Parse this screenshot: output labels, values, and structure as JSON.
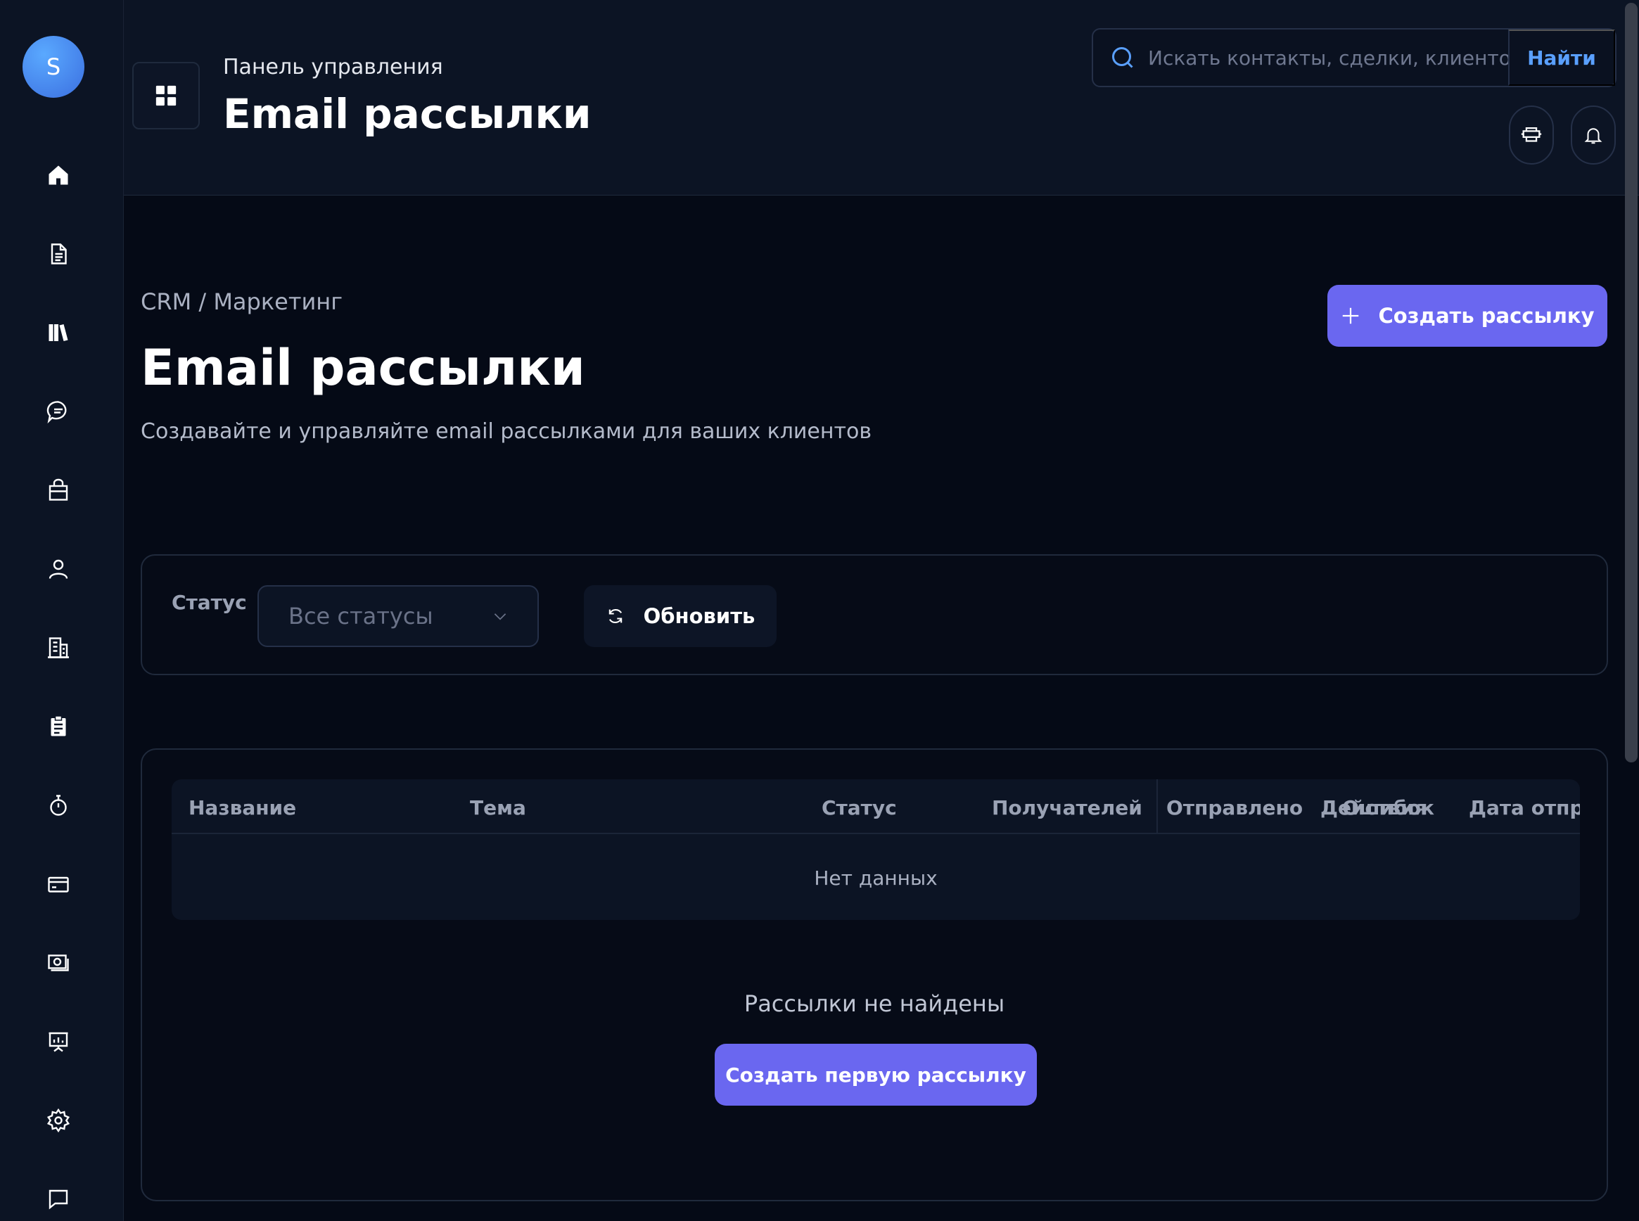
{
  "user": {
    "initial": "S"
  },
  "sidebar": {
    "items": [
      {
        "name": "home",
        "icon": "home-icon"
      },
      {
        "name": "documents",
        "icon": "document-icon"
      },
      {
        "name": "library",
        "icon": "books-icon"
      },
      {
        "name": "messages",
        "icon": "chat-icon"
      },
      {
        "name": "products",
        "icon": "bag-icon"
      },
      {
        "name": "contacts",
        "icon": "user-icon"
      },
      {
        "name": "companies",
        "icon": "building-icon"
      },
      {
        "name": "tasks",
        "icon": "clipboard-icon"
      },
      {
        "name": "timer",
        "icon": "stopwatch-icon"
      },
      {
        "name": "payments",
        "icon": "card-icon"
      },
      {
        "name": "finance",
        "icon": "money-icon"
      },
      {
        "name": "presentations",
        "icon": "presentation-icon"
      },
      {
        "name": "settings",
        "icon": "gear-icon"
      },
      {
        "name": "comments",
        "icon": "message-icon"
      }
    ]
  },
  "header": {
    "subtitle": "Панель управления",
    "title": "Email рассылки",
    "search": {
      "placeholder": "Искать контакты, сделки, клиенто",
      "button_label": "Найти"
    }
  },
  "page": {
    "breadcrumb": "CRM / Маркетинг",
    "title": "Email рассылки",
    "description": "Создавайте и управляйте email рассылками для ваших клиентов",
    "create_button": "Создать рассылку"
  },
  "filters": {
    "status_label": "Статус",
    "status_value": "Все статусы",
    "refresh_label": "Обновить"
  },
  "table": {
    "columns": [
      "Название",
      "Тема",
      "Статус",
      "Получателей",
      "Отправлено",
      "Действия",
      "Ошибок",
      "Дата отпра"
    ],
    "empty_text": "Нет данных"
  },
  "empty_state": {
    "message": "Рассылки не найдены",
    "button_label": "Создать первую рассылку"
  },
  "colors": {
    "accent": "#6a67f0",
    "link": "#5aa0ff",
    "background": "#050a16",
    "surface": "#0c1424"
  }
}
